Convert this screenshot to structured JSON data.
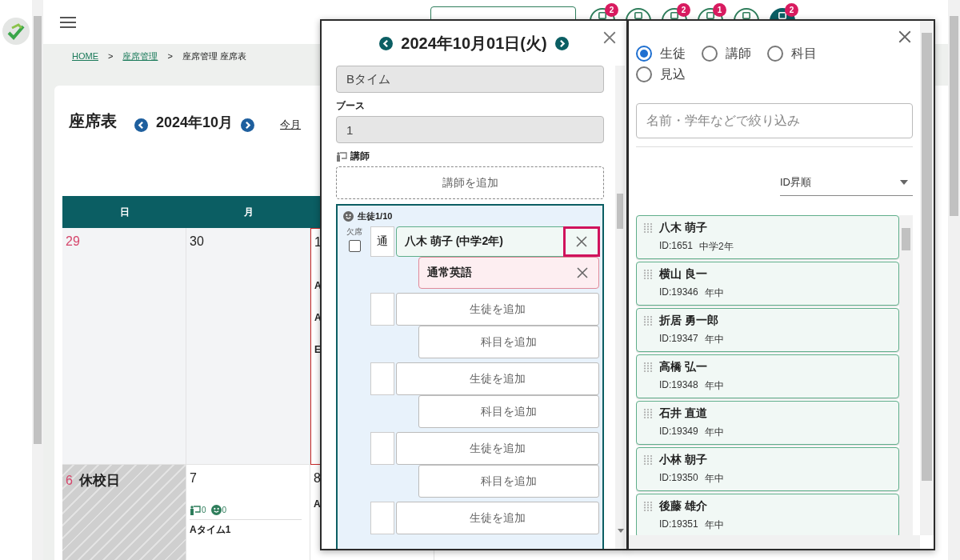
{
  "topbar": {
    "icon_buttons": [
      {
        "badge": "2",
        "selected": false
      },
      {
        "selected": false
      },
      {
        "badge": "2",
        "selected": false
      },
      {
        "badge": "1",
        "selected": false
      },
      {
        "selected": false
      },
      {
        "badge": "2",
        "selected": true
      }
    ]
  },
  "breadcrumbs": [
    {
      "label": "HOME",
      "kind": "link"
    },
    {
      "label": ">",
      "kind": "separator"
    },
    {
      "label": "座席管理",
      "kind": "link"
    },
    {
      "label": ">",
      "kind": "separator"
    },
    {
      "label": "座席管理 座席表",
      "kind": "current"
    }
  ],
  "calendar": {
    "title": "座席表",
    "month": "2024年10月",
    "today_link": "今月",
    "weekdays": [
      {
        "label": "日"
      },
      {
        "label": "月"
      }
    ],
    "weeks": [
      [
        {
          "day": "29",
          "kind": "sunday",
          "selected": false
        },
        {
          "day": "30",
          "kind": "weekday",
          "selected": false
        },
        {
          "day": "1",
          "kind": "weekday",
          "selected": true,
          "lines": [
            "A",
            "A",
            "E"
          ]
        }
      ],
      [
        {
          "day": "6",
          "kind": "holiday",
          "label": "休校日",
          "selected": false
        },
        {
          "day": "7",
          "kind": "weekday",
          "selected": false,
          "teachers": "0",
          "students": "0",
          "slot": "Aタイム1"
        },
        {
          "day": "8",
          "kind": "weekday",
          "selected": false,
          "lines": [
            "A"
          ]
        }
      ]
    ]
  },
  "date_panel": {
    "date": "2024年10月01日(火)",
    "time_slot": "Bタイム",
    "booth_label": "ブース",
    "booth": "1",
    "teacher_label": "講師",
    "add_teacher": "講師を追加",
    "students_label": "生徒1/10",
    "absent_label": "欠席",
    "seats": [
      {
        "kind": "filled",
        "absent": false,
        "type": "通",
        "student": "八木 萌子 (中学2年)",
        "highlighted": true,
        "subject": "通常英語"
      },
      {
        "kind": "empty",
        "add_student": "生徒を追加",
        "add_subject": "科目を追加"
      },
      {
        "kind": "empty",
        "add_student": "生徒を追加",
        "add_subject": "科目を追加"
      },
      {
        "kind": "empty",
        "add_student": "生徒を追加",
        "add_subject": "科目を追加"
      },
      {
        "kind": "empty",
        "add_student": "生徒を追加"
      }
    ]
  },
  "picker": {
    "radios": [
      {
        "label": "生徒",
        "selected": true
      },
      {
        "label": "講師",
        "selected": false
      },
      {
        "label": "科目",
        "selected": false
      },
      {
        "label": "見込",
        "selected": false
      }
    ],
    "search": {
      "placeholder": "名前・学年などで絞り込み"
    },
    "sort": "ID昇順",
    "students": [
      {
        "name": "八木 萌子",
        "id": "ID:1651",
        "grade": "中学2年"
      },
      {
        "name": "横山 良一",
        "id": "ID:19346",
        "grade": "年中"
      },
      {
        "name": "折居 勇一郎",
        "id": "ID:19347",
        "grade": "年中"
      },
      {
        "name": "高橋 弘一",
        "id": "ID:19348",
        "grade": "年中"
      },
      {
        "name": "石井 直道",
        "id": "ID:19349",
        "grade": "年中"
      },
      {
        "name": "小林 朝子",
        "id": "ID:19350",
        "grade": "年中"
      },
      {
        "name": "後藤 雄介",
        "id": "ID:19351",
        "grade": "年中"
      }
    ]
  }
}
